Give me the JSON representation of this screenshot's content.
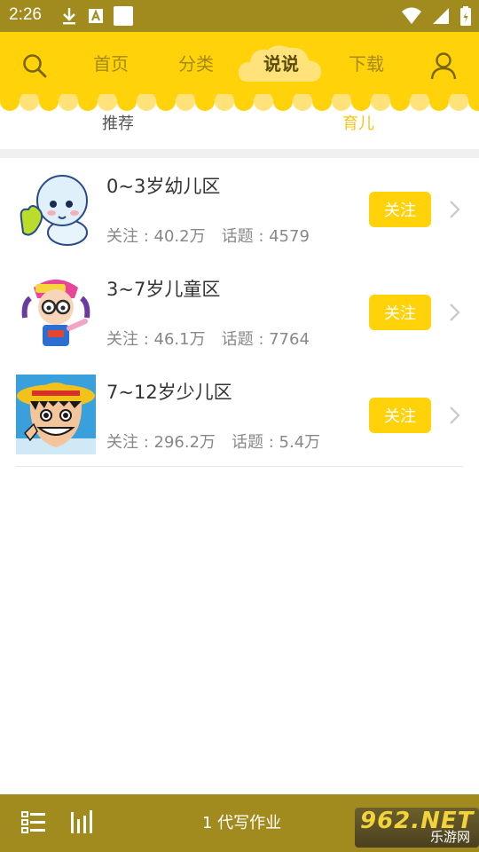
{
  "status_bar": {
    "time": "2:26",
    "left_icons": [
      "download-icon",
      "a-notification-icon",
      "white-square-icon"
    ],
    "right_icons": [
      "wifi-icon",
      "cell-signal-icon",
      "battery-icon"
    ]
  },
  "header": {
    "icons": [
      "search-icon",
      "user-icon"
    ],
    "tabs": [
      {
        "label": "首页",
        "active": false
      },
      {
        "label": "分类",
        "active": false
      },
      {
        "label": "说说",
        "active": true
      },
      {
        "label": "下载",
        "active": false
      }
    ]
  },
  "sub_tabs": [
    {
      "label": "推荐",
      "active": false
    },
    {
      "label": "育儿",
      "active": true
    }
  ],
  "colors": {
    "accent": "#ffd20a",
    "status_bar": "#a28b1e",
    "active_sub_tab": "#f5c518",
    "inactive_sub_tab": "#555555"
  },
  "items": [
    {
      "title": "0~3岁幼儿区",
      "follow_stat": "关注 : 40.2万",
      "topic_stat": "话题 : 4579",
      "button": "关注"
    },
    {
      "title": "3~7岁儿童区",
      "follow_stat": "关注 : 46.1万",
      "topic_stat": "话题 : 7764",
      "button": "关注"
    },
    {
      "title": "7~12岁少儿区",
      "follow_stat": "关注 : 296.2万",
      "topic_stat": "话题 : 5.4万",
      "button": "关注"
    }
  ],
  "bottom_bar": {
    "icons": [
      "list-icon",
      "bars-icon"
    ],
    "text": "1 代写作业",
    "watermark_main": "962.NET",
    "watermark_sub": "乐游网"
  }
}
